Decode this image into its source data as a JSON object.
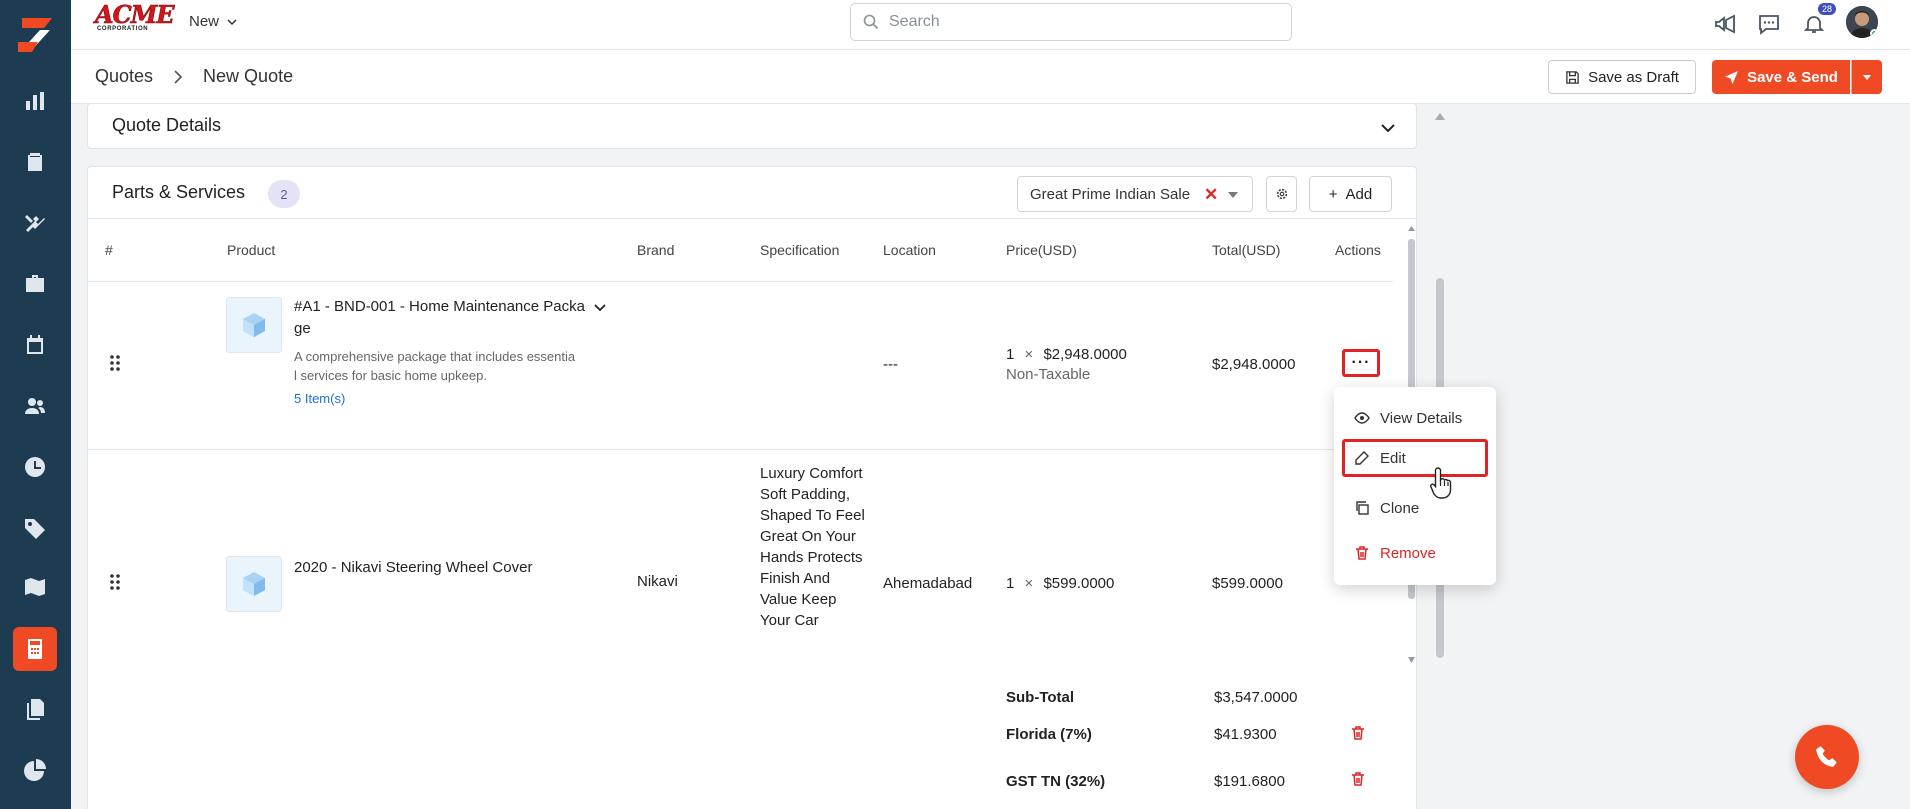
{
  "app": {
    "brand_name": "ACME",
    "brand_sub": "CORPORATION"
  },
  "topbar": {
    "new_label": "New",
    "search_placeholder": "Search",
    "notification_count": "28"
  },
  "breadcrumb": {
    "root": "Quotes",
    "current": "New Quote"
  },
  "header_actions": {
    "save_draft": "Save as Draft",
    "save_send": "Save & Send"
  },
  "quote_details": {
    "title": "Quote Details"
  },
  "parts": {
    "title": "Parts & Services",
    "count": "2",
    "tax_selected": "Great Prime Indian Sale",
    "add_label": "Add",
    "columns": [
      "#",
      "Product",
      "Brand",
      "Specification",
      "Location",
      "Price(USD)",
      "Total(USD)",
      "Actions"
    ],
    "rows": [
      {
        "title_line1": "#A1 - BND-001 - Home Maintenance Packa",
        "title_line2": "ge",
        "desc_line1": "A comprehensive package that includes essentia",
        "desc_line2": "l services for basic home upkeep.",
        "link": "5 Item(s)",
        "brand": "",
        "location": "---",
        "qty": "1",
        "times": "×",
        "price": "$2,948.0000",
        "tax_note": "Non-Taxable",
        "total": "$2,948.0000"
      },
      {
        "title_line1": "2020 - Nikavi Steering Wheel Cover",
        "brand": "Nikavi",
        "spec": "Luxury Comfort Soft Padding, Shaped To Feel Great On Your Hands Protects Finish And Value Keep Your Car",
        "location": "Ahemadabad",
        "qty": "1",
        "times": "×",
        "price": "$599.0000",
        "total": "$599.0000"
      }
    ],
    "totals": [
      {
        "label": "Sub-Total",
        "value": "$3,547.0000"
      },
      {
        "label": "Florida (7%)",
        "value": "$41.9300"
      },
      {
        "label": "GST TN (32%)",
        "value": "$191.6800"
      }
    ]
  },
  "actions_menu": {
    "items": [
      "View Details",
      "Edit",
      "Clone",
      "Remove"
    ]
  },
  "colors": {
    "accent": "#ef4a23",
    "sidebar": "#1d3b51",
    "danger": "#e02424",
    "link": "#1e6fd9"
  }
}
